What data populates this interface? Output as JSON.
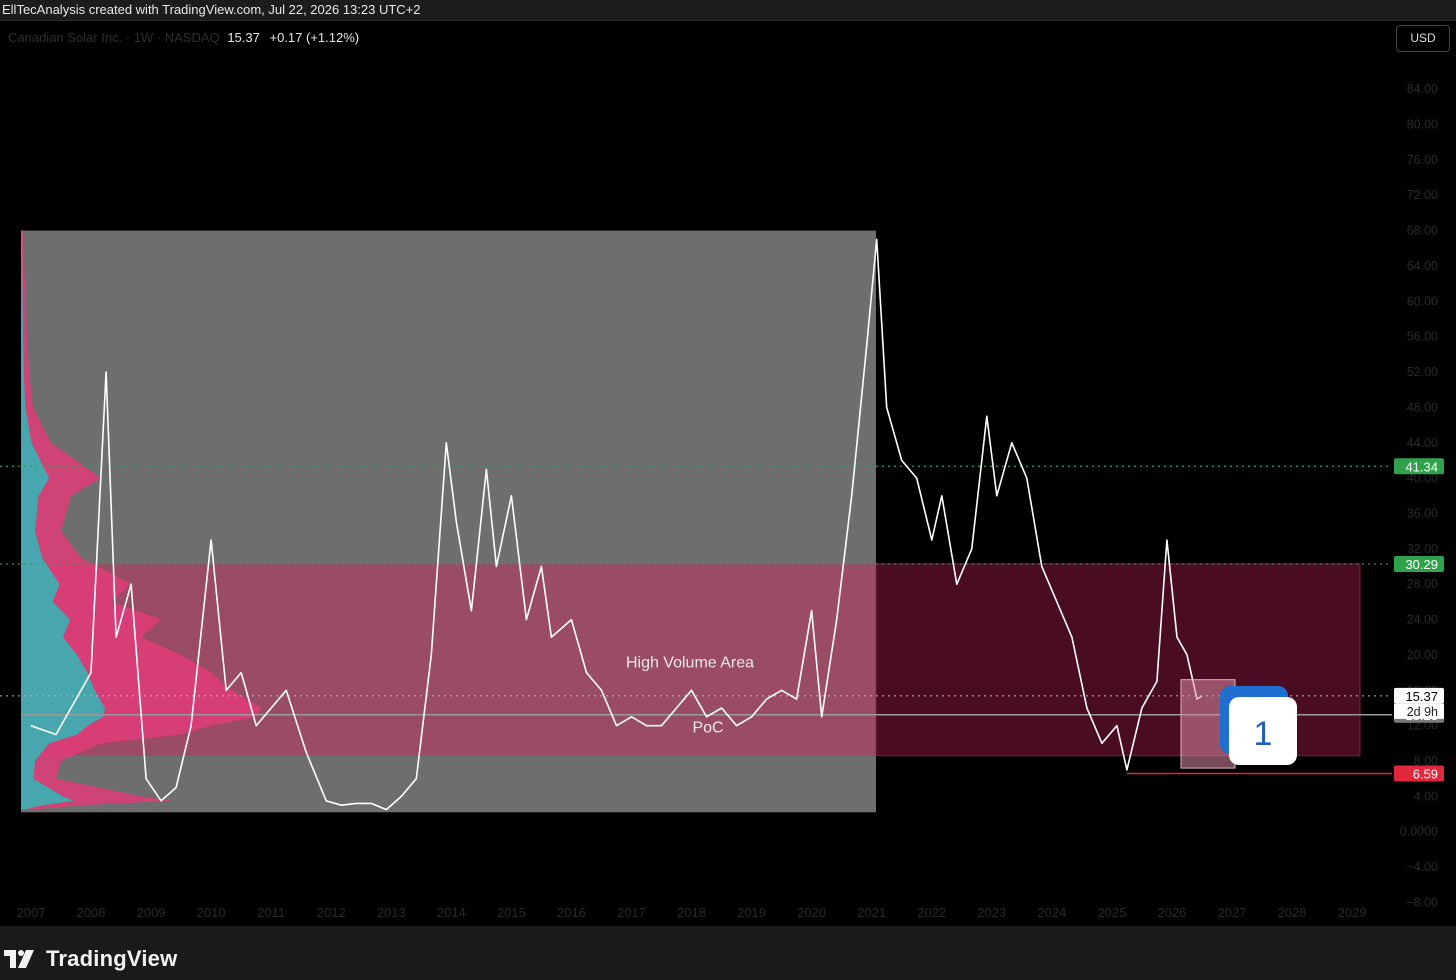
{
  "header": {
    "attribution": "EllTecAnalysis created with TradingView.com, Jul 22, 2026 13:23 UTC+2",
    "symbol": "Canadian Solar Inc. · 1W · NASDAQ",
    "price": "15.37",
    "change": "+0.17 (+1.12%)",
    "currency": "USD"
  },
  "branding": {
    "name": "TradingView"
  },
  "chart_data": {
    "type": "line",
    "series": [
      {
        "x": [
          "2007-01",
          "2007-06",
          "2008-01",
          "2008-04",
          "2008-06",
          "2008-09",
          "2008-12",
          "2009-03",
          "2009-06",
          "2009-09",
          "2010-01",
          "2010-04",
          "2010-07",
          "2010-10",
          "2011-01",
          "2011-04",
          "2011-08",
          "2011-12",
          "2012-03",
          "2012-06",
          "2012-09",
          "2012-12",
          "2013-03",
          "2013-06",
          "2013-09",
          "2013-12",
          "2014-02",
          "2014-05",
          "2014-08",
          "2014-10",
          "2015-01",
          "2015-04",
          "2015-07",
          "2015-09",
          "2016-01",
          "2016-04",
          "2016-07",
          "2016-10",
          "2017-01",
          "2017-04",
          "2017-07",
          "2017-10",
          "2018-01",
          "2018-04",
          "2018-07",
          "2018-10",
          "2019-01",
          "2019-04",
          "2019-07",
          "2019-10",
          "2020-01",
          "2020-03",
          "2020-06",
          "2020-09",
          "2020-12",
          "2021-02",
          "2021-04",
          "2021-07",
          "2021-10",
          "2022-01",
          "2022-03",
          "2022-06",
          "2022-09",
          "2022-12",
          "2023-02",
          "2023-05",
          "2023-08",
          "2023-11",
          "2024-02",
          "2024-05",
          "2024-08",
          "2024-11",
          "2025-02",
          "2025-04",
          "2025-07",
          "2025-10",
          "2025-12",
          "2026-02",
          "2026-04",
          "2026-06",
          "2026-07"
        ],
        "values": [
          12,
          11,
          18,
          52,
          22,
          28,
          6,
          3.5,
          5,
          12,
          33,
          16,
          18,
          12,
          14,
          16,
          9,
          3.5,
          3,
          3.2,
          3.2,
          2.5,
          4,
          6,
          20,
          44,
          35,
          25,
          41,
          30,
          38,
          24,
          30,
          22,
          24,
          18,
          16,
          12,
          13,
          12,
          12,
          14,
          16,
          13,
          14,
          12,
          13,
          15,
          16,
          15,
          25,
          13,
          24,
          38,
          55,
          67,
          48,
          42,
          40,
          33,
          38,
          28,
          32,
          47,
          38,
          44,
          40,
          30,
          26,
          22,
          14,
          10,
          12,
          7,
          14,
          17,
          33,
          22,
          20,
          15,
          15.37
        ]
      }
    ],
    "y_ticks": [
      "84.00",
      "80.00",
      "76.00",
      "72.00",
      "68.00",
      "64.00",
      "60.00",
      "56.00",
      "52.00",
      "48.00",
      "44.00",
      "40.00",
      "36.00",
      "32.00",
      "28.00",
      "24.00",
      "20.00",
      "16.00",
      "12.00",
      "8.00",
      "4.00",
      "0.0000",
      "−4.00",
      "−8.00"
    ],
    "x_ticks": [
      "2007",
      "2008",
      "2009",
      "2010",
      "2011",
      "2012",
      "2013",
      "2014",
      "2015",
      "2016",
      "2017",
      "2018",
      "2019",
      "2020",
      "2021",
      "2022",
      "2023",
      "2024",
      "2025",
      "2026",
      "2027",
      "2028",
      "2029"
    ],
    "ylim": [
      -8.4,
      88.2
    ],
    "levels": [
      {
        "label": "41.34",
        "value": 41.34,
        "color": "#31a24c"
      },
      {
        "label": "30.29",
        "value": 30.29,
        "color": "#31a24c"
      },
      {
        "label": "15.37",
        "value": 15.37,
        "color": "#ffffff"
      },
      {
        "label": "13.23",
        "value": 13.23,
        "color": "#7a7a7a"
      },
      {
        "label": "6.59",
        "value": 6.59,
        "color": "#e0283a"
      }
    ],
    "countdown": "2d 9h",
    "annotations": {
      "zone": "High Volume Area",
      "poc": "PoC",
      "count_label": "1"
    },
    "colors": {
      "price_line": "#ffffff",
      "zone": "#c0325e",
      "profile_pink": "#e23c78",
      "profile_teal": "#2fb8b8",
      "grey_box": "#6e6e6e",
      "dark_zone": "#4a0c22"
    }
  }
}
